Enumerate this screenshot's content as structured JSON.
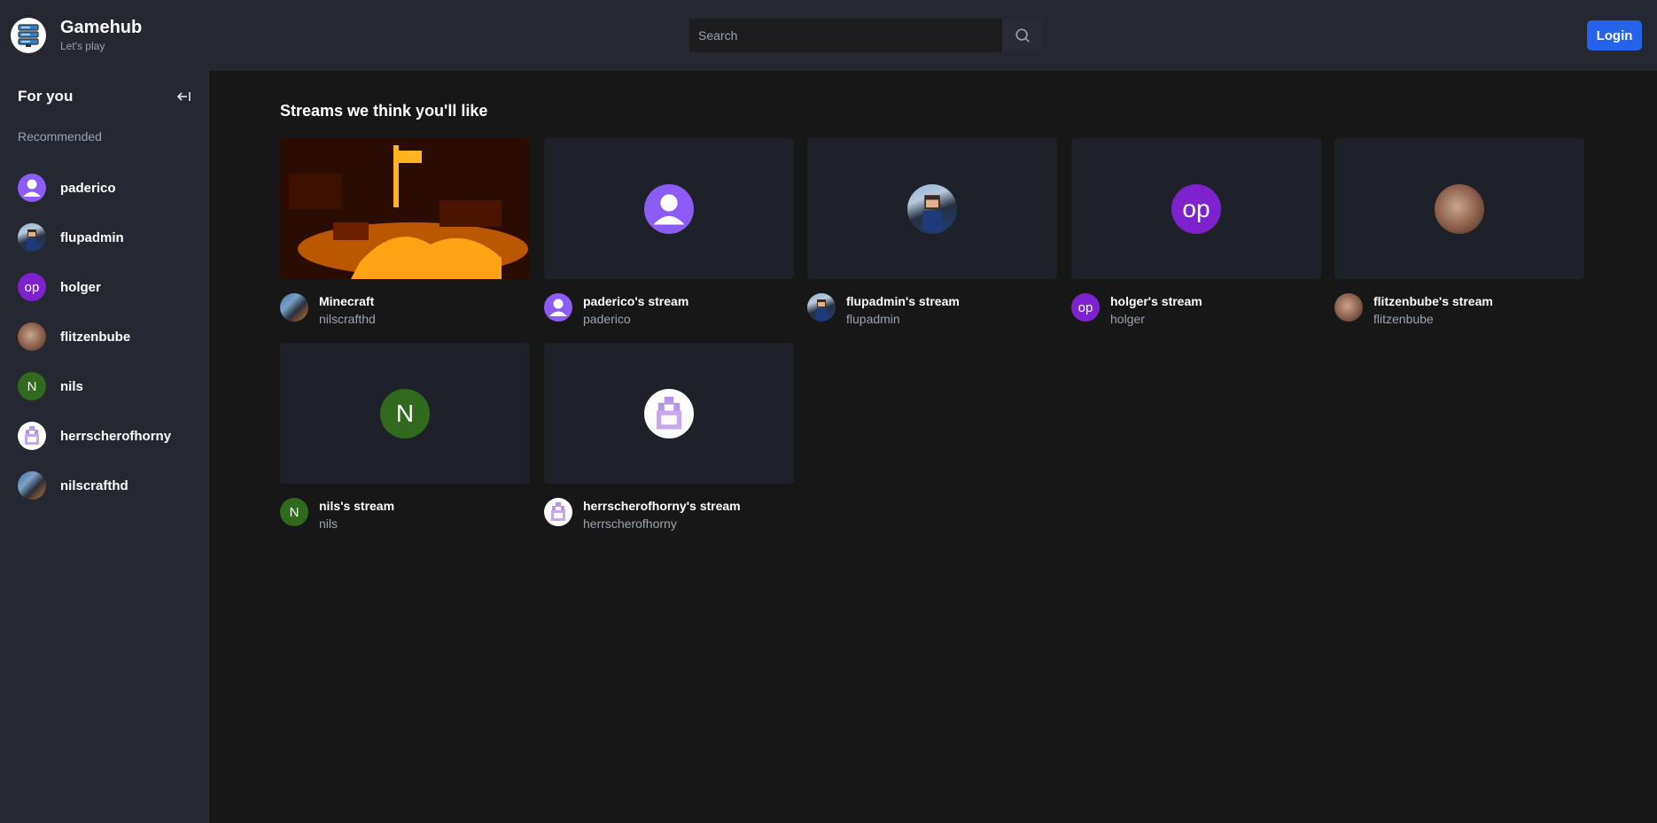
{
  "header": {
    "brand_title": "Gamehub",
    "brand_subtitle": "Let's play",
    "search_placeholder": "Search",
    "login_label": "Login"
  },
  "sidebar": {
    "title": "For you",
    "section_label": "Recommended",
    "items": [
      {
        "name": "paderico",
        "avatar": "user-icon"
      },
      {
        "name": "flupadmin",
        "avatar": "image"
      },
      {
        "name": "holger",
        "avatar": "op"
      },
      {
        "name": "flitzenbube",
        "avatar": "image"
      },
      {
        "name": "nils",
        "avatar": "N"
      },
      {
        "name": "herrscherofhorny",
        "avatar": "image"
      },
      {
        "name": "nilscrafthd",
        "avatar": "image"
      }
    ]
  },
  "main": {
    "section_title": "Streams we think you'll like",
    "streams": [
      {
        "title": "Minecraft",
        "user": "nilscrafthd"
      },
      {
        "title": "paderico's stream",
        "user": "paderico"
      },
      {
        "title": "flupadmin's stream",
        "user": "flupadmin"
      },
      {
        "title": "holger's stream",
        "user": "holger",
        "initials": "op"
      },
      {
        "title": "flitzenbube's stream",
        "user": "flitzenbube"
      },
      {
        "title": "nils's stream",
        "user": "nils",
        "initials": "N"
      },
      {
        "title": "herrscherofhorny's stream",
        "user": "herrscherofhorny"
      }
    ]
  },
  "colors": {
    "background": "#171717",
    "panel": "#252731",
    "card": "#1f2128",
    "accent": "#2563eb"
  }
}
